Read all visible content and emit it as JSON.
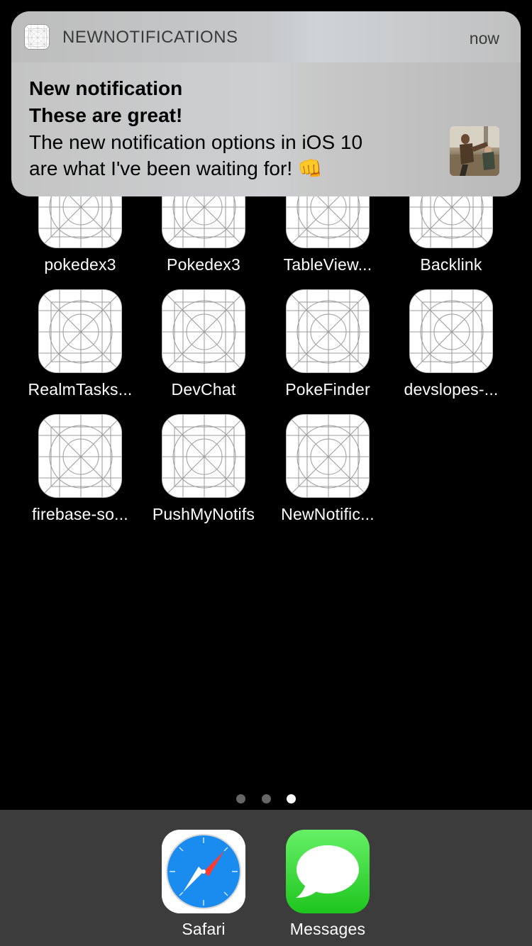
{
  "notification": {
    "app_name": "NEWNOTIFICATIONS",
    "time": "now",
    "title": "New notification",
    "subtitle": "These are great!",
    "body_line1": "The new notification options in iOS 10",
    "body_line2": "are what I've been waiting for!",
    "emoji": "👊",
    "app_icon": "placeholder-app-icon",
    "thumbnail": "attachment-image-thumbnail"
  },
  "apps": [
    {
      "label": "pokedex3"
    },
    {
      "label": "Pokedex3"
    },
    {
      "label": "TableView..."
    },
    {
      "label": "Backlink"
    },
    {
      "label": "RealmTasks..."
    },
    {
      "label": "DevChat"
    },
    {
      "label": "PokeFinder"
    },
    {
      "label": "devslopes-..."
    },
    {
      "label": "firebase-so..."
    },
    {
      "label": "PushMyNotifs"
    },
    {
      "label": "NewNotific..."
    }
  ],
  "page_indicator": {
    "pages": 3,
    "current": 3
  },
  "dock": [
    {
      "label": "Safari",
      "icon": "safari-compass-icon"
    },
    {
      "label": "Messages",
      "icon": "messages-bubble-icon"
    }
  ],
  "colors": {
    "background": "#000000",
    "dock": "#3c3c3c",
    "messages_green": "#2ecc40",
    "safari_blue": "#1a8cf0"
  }
}
